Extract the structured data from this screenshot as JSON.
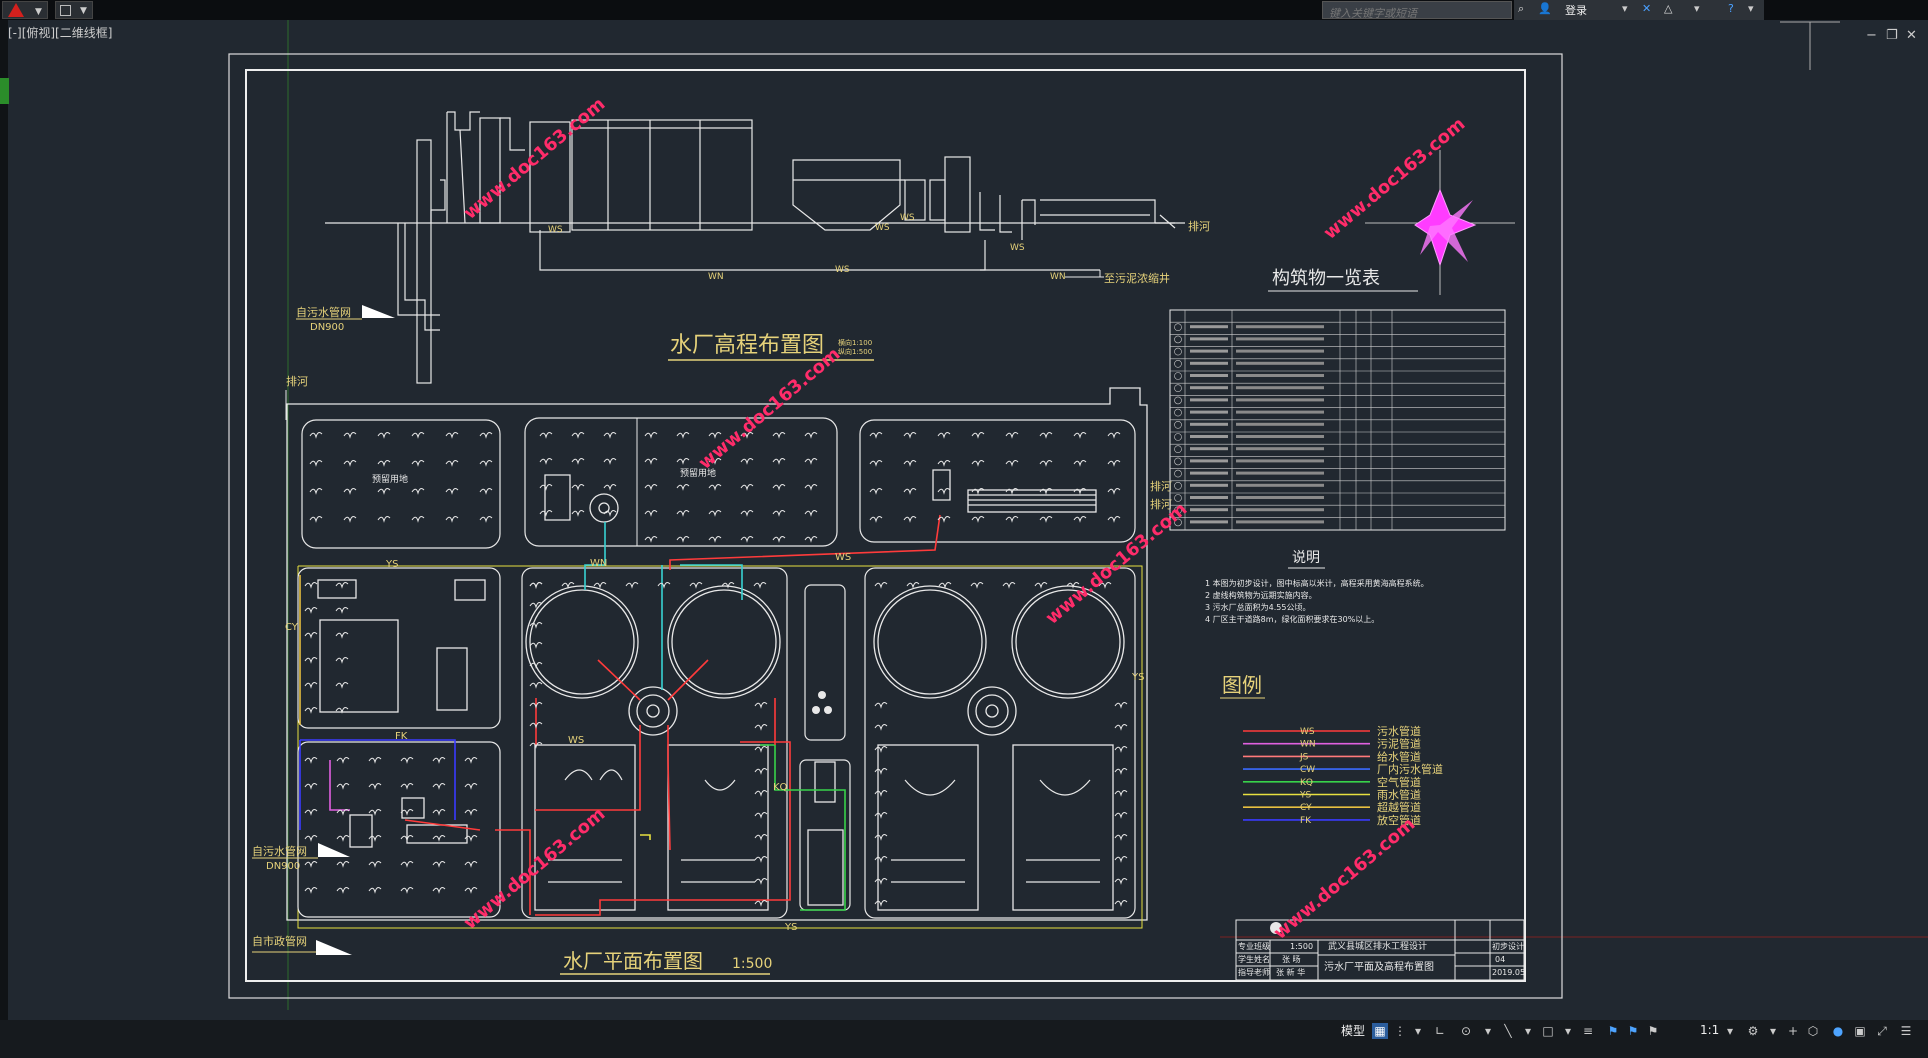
{
  "toolbar": {
    "search_placeholder": "键入关键字或短语",
    "login_label": "登录"
  },
  "viewport": {
    "view_label": "[-][俯视][二维线框]"
  },
  "drawing": {
    "section_title": "水厂高程布置图",
    "section_scale_h": "横向1:100",
    "section_scale_v": "纵向1:500",
    "plan_title": "水厂平面布置图",
    "plan_scale": "1:500",
    "drain_label_top": "排河",
    "drain_label_left": "排河",
    "drain_label_right": "排河",
    "sludge_label": "至污泥浓缩井",
    "inflow_label_top": "自污水管网",
    "inflow_dn_top": "DN900",
    "inflow_label_mid": "自污水管网",
    "inflow_dn_mid": "DN900",
    "inflow_label_bottom": "自市政管网",
    "reserved_label_1": "预留用地",
    "reserved_label_2": "预留用地",
    "pipe_ws": "WS",
    "pipe_wn": "WN",
    "pipe_ys": "YS",
    "pipe_fk": "FK",
    "pipe_cy": "CY",
    "pipe_kq": "KQ",
    "structures_title": "构筑物一览表",
    "notes_title": "说明",
    "notes": [
      "1 本图为初步设计，图中标高以米计，高程采用黄海高程系统。",
      "2 虚线构筑物为远期实施内容。",
      "3 污水厂总面积为4.55公顷。",
      "4 厂区主干道路8m，绿化面积要求在30%以上。"
    ],
    "legend_title": "图例",
    "legend": [
      {
        "code": "WS",
        "label": "污水管道",
        "color": "#ff3b3b"
      },
      {
        "code": "WN",
        "label": "污泥管道",
        "color": "#e060e0"
      },
      {
        "code": "JS",
        "label": "给水管道",
        "color": "#ff7a7a"
      },
      {
        "code": "CW",
        "label": "厂内污水管道",
        "color": "#3a6bff"
      },
      {
        "code": "KQ",
        "label": "空气管道",
        "color": "#38d24a"
      },
      {
        "code": "YS",
        "label": "雨水管道",
        "color": "#e8e040"
      },
      {
        "code": "CY",
        "label": "超越管道",
        "color": "#e8c040"
      },
      {
        "code": "FK",
        "label": "放空管道",
        "color": "#3a3aff"
      }
    ],
    "title_block": {
      "project": "武义县城区排水工程设计",
      "drawing_name": "污水厂平面及高程布置图",
      "stage": "初步设计",
      "scale": "1:500",
      "sheet_no": "04",
      "date": "2019.05",
      "row1": "专业班级",
      "row2": "学生姓名",
      "row3": "指导老师",
      "student": "张 旸",
      "teacher": "张 新 华"
    },
    "watermark": "www.doc163.com"
  },
  "statusbar": {
    "model_label": "模型",
    "scale_label": "1:1"
  }
}
